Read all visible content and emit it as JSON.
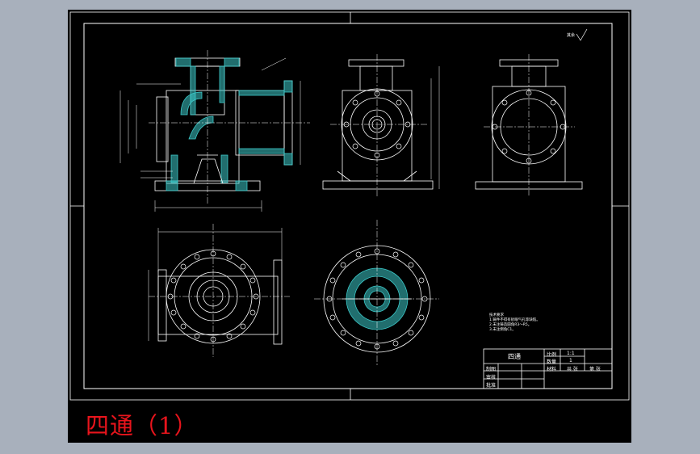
{
  "caption": "四通（1）",
  "colors": {
    "background": "#a8b0bc",
    "sheet": "#000000",
    "line": "#ffffff",
    "hatch": "#3cc9c9",
    "caption": "#e8141c"
  },
  "title_block": {
    "part_name": "四通",
    "scale_label": "比例",
    "scale_value": "1:1",
    "count_label": "数量",
    "count_value": "1",
    "material_label": "材料",
    "sheet_cells": [
      "共  张",
      "第  张"
    ],
    "draw_label": "制图",
    "check_label": "审核",
    "approve_label": "批准"
  },
  "notes": {
    "title": "技术要求",
    "lines": [
      "1.铸件不得有砂眼气孔等缺陷。",
      "2.未注铸造圆角R3～R5。",
      "3.未注倒角C1。"
    ]
  },
  "roughness_note": "其余"
}
